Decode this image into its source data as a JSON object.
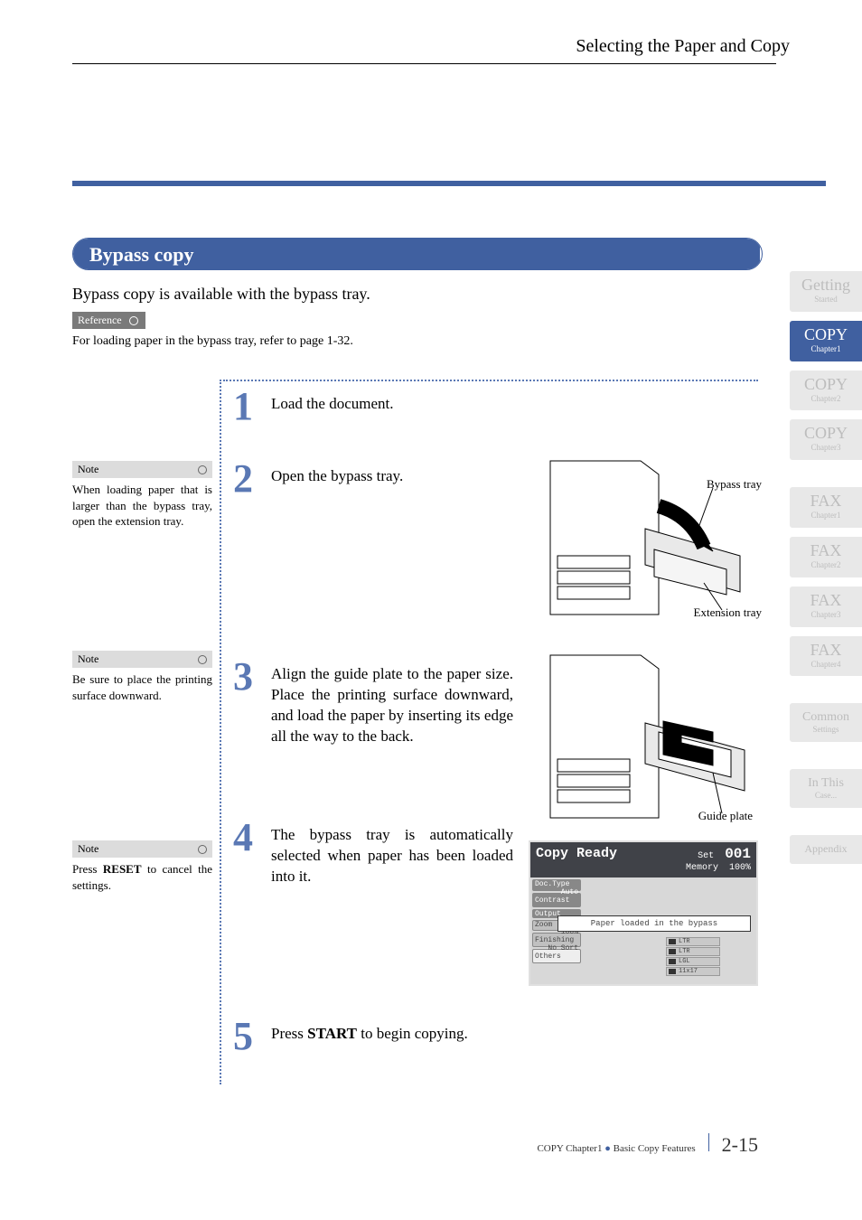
{
  "header": {
    "title": "Selecting the Paper and Copy"
  },
  "section": {
    "title": "Bypass copy",
    "intro": "Bypass copy is available with the bypass tray.",
    "reference_label": "Reference",
    "reference_text": "For loading paper in the bypass tray, refer to page 1-32."
  },
  "steps": [
    {
      "num": "1",
      "text": "Load the document."
    },
    {
      "num": "2",
      "text": "Open the bypass tray."
    },
    {
      "num": "3",
      "text": "Align the guide plate to the paper size. Place the printing surface downward, and load the paper by inserting its edge all the way to the back."
    },
    {
      "num": "4",
      "text": "The bypass tray is automatically selected when paper has been loaded into it."
    },
    {
      "num": "5",
      "text_prefix": "Press ",
      "text_bold": "START",
      "text_suffix": " to begin copying."
    }
  ],
  "notes": [
    {
      "label": "Note",
      "text": "When loading paper that is larger than the bypass tray, open the extension tray."
    },
    {
      "label": "Note",
      "text": "Be sure to place the printing surface downward."
    },
    {
      "label": "Note",
      "text_prefix": "Press ",
      "text_bold": "RESET",
      "text_suffix": " to cancel the settings."
    }
  ],
  "illus": {
    "bypass_label": "Bypass tray",
    "extension_label": "Extension tray",
    "guide_label": "Guide plate"
  },
  "screen": {
    "title": "Copy Ready",
    "set_label": "Set",
    "count": "001",
    "mem_label": "Memory",
    "mem_val": "100%",
    "side_buttons": [
      {
        "l1": "Doc.Type",
        "l2": "Auto"
      },
      {
        "l1": "Contrast",
        "l2": ""
      },
      {
        "l1": "Output",
        "l2": ""
      },
      {
        "l1": "Zoom",
        "l2": "100%"
      },
      {
        "l1": "Finishing",
        "l2": "No Sort"
      },
      {
        "l1": "Others",
        "l2": ""
      }
    ],
    "message": "Paper loaded in the bypass",
    "trays": [
      "LTR",
      "LTR",
      "LGL",
      "11x17"
    ]
  },
  "tabs": [
    {
      "title": "Getting",
      "sub": "Started",
      "active": false
    },
    {
      "title": "COPY",
      "sub": "Chapter1",
      "active": true
    },
    {
      "title": "COPY",
      "sub": "Chapter2",
      "active": false
    },
    {
      "title": "COPY",
      "sub": "Chapter3",
      "active": false
    },
    {
      "title": "FAX",
      "sub": "Chapter1",
      "active": false
    },
    {
      "title": "FAX",
      "sub": "Chapter2",
      "active": false
    },
    {
      "title": "FAX",
      "sub": "Chapter3",
      "active": false
    },
    {
      "title": "FAX",
      "sub": "Chapter4",
      "active": false
    },
    {
      "title": "Common",
      "sub": "Settings",
      "active": false
    },
    {
      "title": "In This",
      "sub": "Case...",
      "active": false
    },
    {
      "title": "Appendix",
      "sub": "",
      "active": false
    }
  ],
  "footer": {
    "chapter": "COPY Chapter1",
    "bullet": "●",
    "section": "Basic Copy Features",
    "page": "2-15"
  }
}
